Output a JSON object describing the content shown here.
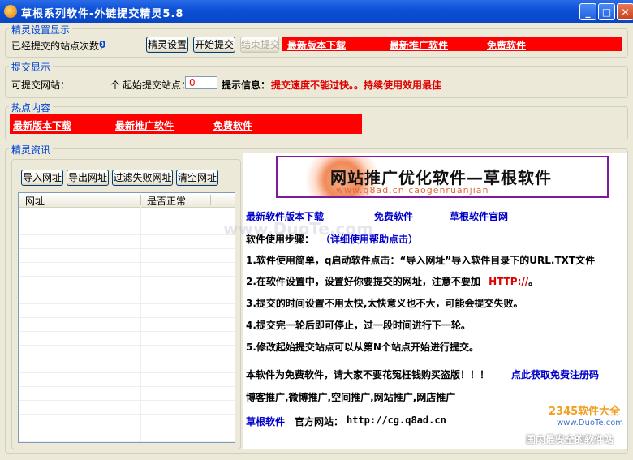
{
  "window": {
    "title": "草根系列软件-外链提交精灵5.8",
    "min_label": "_",
    "max_label": "□",
    "close_label": "✕"
  },
  "settings": {
    "group_label": "精灵设置显示",
    "submitted_label": "已经提交的站点次数：",
    "submitted_count": "0",
    "btn_settings": "精灵设置",
    "btn_start": "开始提交",
    "btn_stop": "结束提交",
    "links": [
      "最新版本下载",
      "最新推广软件",
      "免费软件"
    ]
  },
  "submit": {
    "group_label": "提交显示",
    "available_label": "可提交网站：",
    "unit_label": "个",
    "start_label": "起始提交站点：",
    "start_value": "0",
    "tip_label": "提示信息：",
    "tip_text": "提交速度不能过快。。持续使用效用最佳"
  },
  "hot": {
    "group_label": "热点内容",
    "links": [
      "最新版本下载",
      "最新推广软件",
      "免费软件"
    ]
  },
  "info": {
    "group_label": "精灵资讯",
    "btn_import": "导入网址",
    "btn_export": "导出网址",
    "btn_filter": "过滤失败网址",
    "btn_clear": "清空网址",
    "columns": [
      "网址",
      "是否正常"
    ]
  },
  "panel": {
    "banner_title": "网站推广优化软件—草根软件",
    "banner_sub": "www.q8ad.cn  caogenruanjian",
    "links": [
      "最新软件版本下载",
      "免费软件",
      "草根软件官网"
    ],
    "steps_label": "软件使用步骤：",
    "steps_link": "（详细使用帮助点击）",
    "step1": "1.软件使用简单，q启动软件点击：“导入网址”导入软件目录下的URL.TXT文件",
    "step2a": "2.在软件设置中，设置好你要提交的网址，注意不要加",
    "step2b": "HTTP://",
    "step2c": "。",
    "step3": "3.提交的时间设置不用太快,太快意义也不大，可能会提交失败。",
    "step4": "4.提交完一轮后即可停止，过一段时间进行下一轮。",
    "step5": "5.修改起始提交站点可以从第N个站点开始进行提交。",
    "free_text": "本软件为免费软件，请大家不要花冤枉钱购买盗版！！！",
    "free_link": "点此获取免费注册码",
    "promo": "博客推广,微博推广,空间推广,网站推广,网店推广",
    "brand_link": "草根软件",
    "site_label": "官方网站：",
    "site_url": "http://cg.q8ad.cn"
  },
  "watermarks": {
    "center": "www.DuoTe.com",
    "corner_brand": "2345软件大全",
    "corner_url": "www.DuoTe.com",
    "corner_slogan": "国内最安全的软件站"
  }
}
